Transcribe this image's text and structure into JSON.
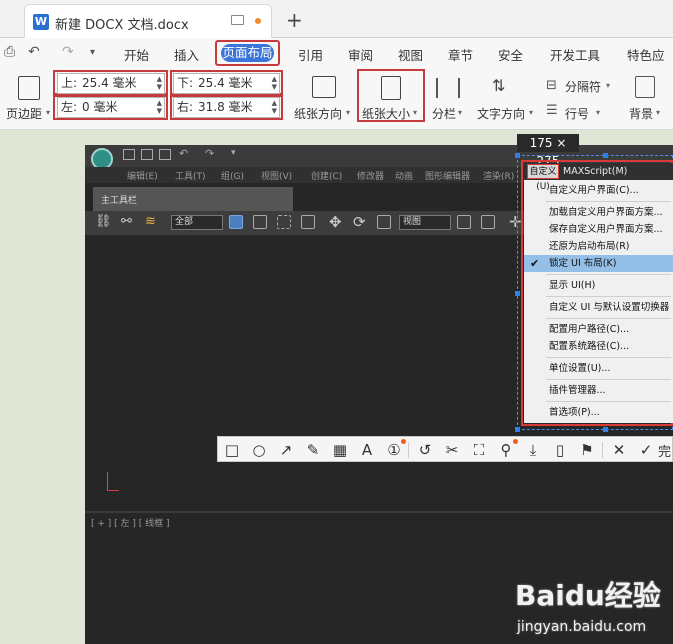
{
  "tab": {
    "icon": "W",
    "title": "新建 DOCX 文档.docx"
  },
  "tabbar": {
    "new_tab": "+"
  },
  "menubar": {
    "items": [
      "开始",
      "插入",
      "页面布局",
      "引用",
      "审阅",
      "视图",
      "章节",
      "安全",
      "开发工具",
      "特色应"
    ]
  },
  "ribbon": {
    "margins_label": "页边距",
    "top_label": "上:",
    "top_value": "25.4 毫米",
    "bottom_label": "下:",
    "bottom_value": "25.4 毫米",
    "left_label": "左:",
    "left_value": "0 毫米",
    "right_label": "右:",
    "right_value": "31.8 毫米",
    "orientation_label": "纸张方向",
    "size_label": "纸张大小",
    "columns_label": "分栏",
    "text_direction_label": "文字方向",
    "separator_label": "分隔符",
    "line_number_label": "行号",
    "background_label": "背景"
  },
  "max_app": {
    "menus": [
      "编辑(E)",
      "工具(T)",
      "组(G)",
      "视图(V)",
      "创建(C)",
      "修改器",
      "动画",
      "图形编辑器",
      "渲染(R)"
    ],
    "toolbar_label": "主工具栏",
    "filter_value": "全部",
    "view_value": "视图",
    "viewport_label": "[ + ] [ 左 ] [ 线框 ]"
  },
  "capture": {
    "size_text": "175 × 275"
  },
  "context_menu": {
    "tabs": [
      "自定义(U)",
      "MAXScript(M)"
    ],
    "items": [
      "自定义用户界面(C)...",
      "加载自定义用户界面方案...",
      "保存自定义用户界面方案...",
      "还原为启动布局(R)",
      "锁定 UI 布局(K)",
      "显示 UI(H)",
      "自定义 UI 与默认设置切换器",
      "配置用户路径(C)...",
      "配置系统路径(C)...",
      "单位设置(U)...",
      "插件管理器...",
      "首选项(P)..."
    ],
    "checked_item": "锁定 UI 布局(K)"
  },
  "snip_toolbar": {
    "finish_label": "完"
  },
  "watermark": {
    "brand": "Baidu经验",
    "url": "jingyan.baidu.com"
  },
  "colors": {
    "accent": "#3a75d9",
    "highlight_red": "#c53b3b",
    "selection": "#94bfe6"
  }
}
